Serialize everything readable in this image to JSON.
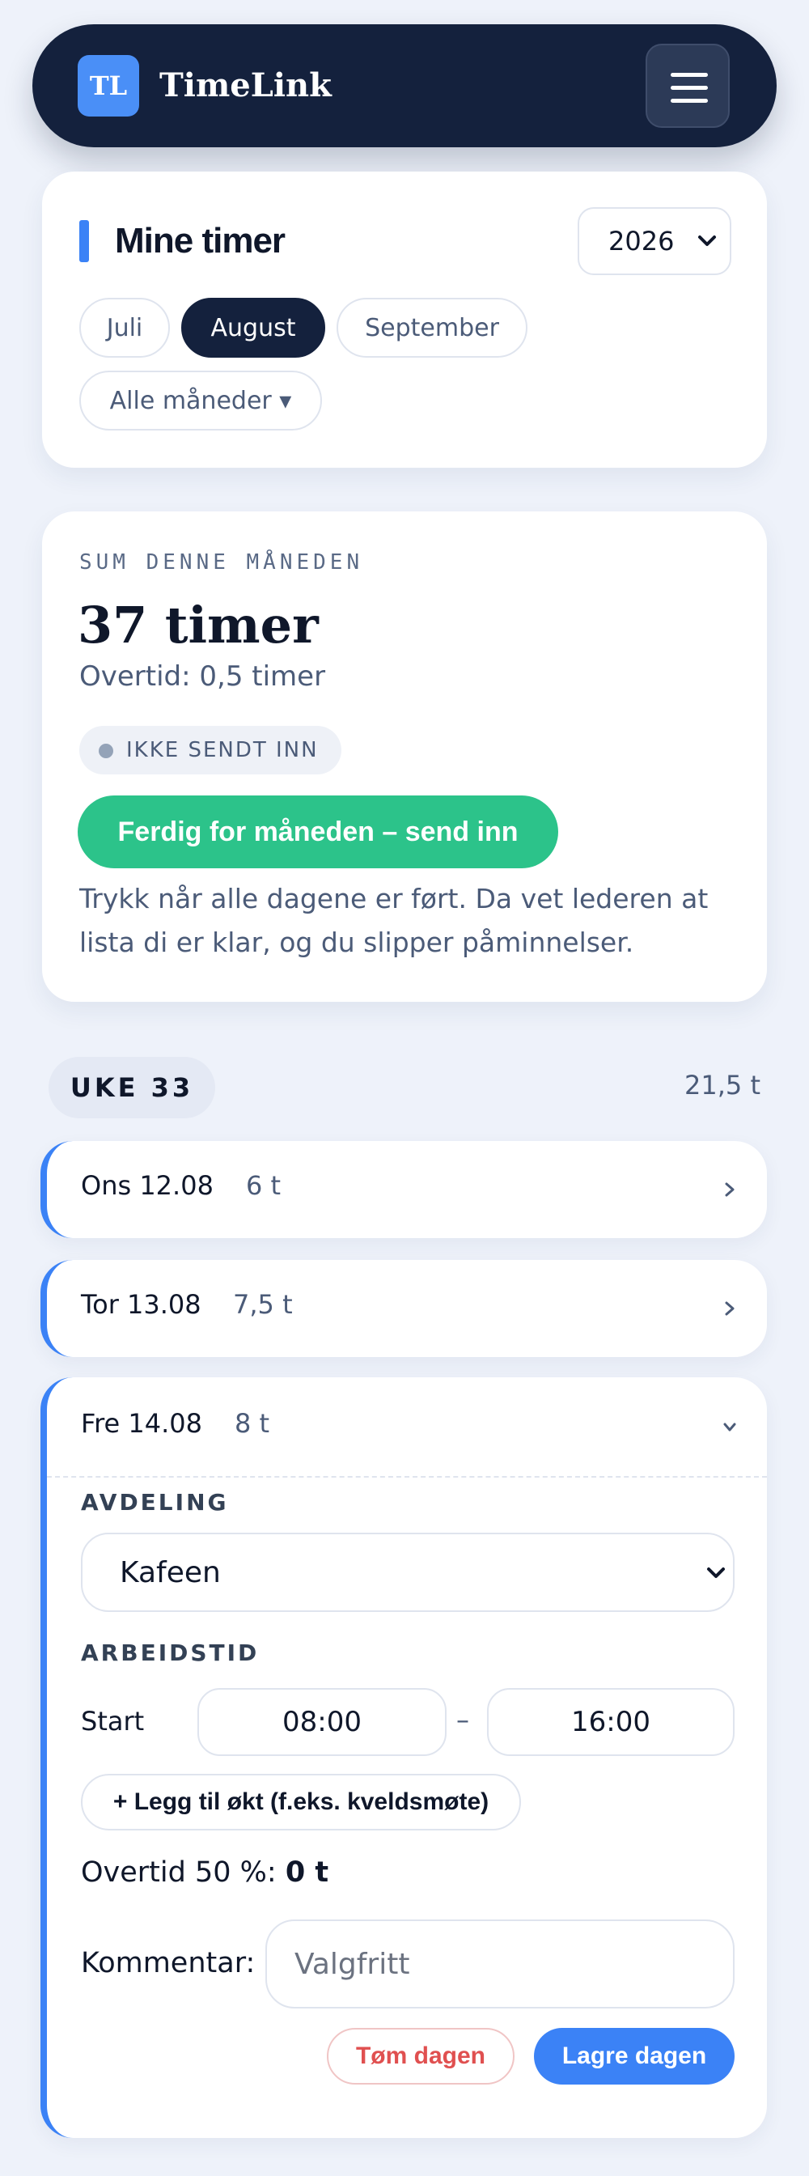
{
  "header": {
    "logo_text": "TL",
    "brand": "TimeLink",
    "menu_icon": "hamburger-icon"
  },
  "hours_card": {
    "title": "Mine timer",
    "year": "2026",
    "months": [
      {
        "label": "Juli",
        "active": false
      },
      {
        "label": "August",
        "active": true
      },
      {
        "label": "September",
        "active": false
      }
    ],
    "all_months": "Alle måneder ▾"
  },
  "summary": {
    "caption": "SUM DENNE MÅNEDEN",
    "total": "37 timer",
    "overtime": "Overtid: 0,5 timer",
    "status": "IKKE SENDT INN",
    "submit_label": "Ferdig for måneden – send inn",
    "help_text": "Trykk når alle dagene er ført. Da vet lederen at lista di er klar, og du slipper påminnelser."
  },
  "week": {
    "label": "UKE 33",
    "total": "21,5 t",
    "days": [
      {
        "name": "Ons 12.08",
        "hours": "6 t",
        "expanded": false
      },
      {
        "name": "Tor 13.08",
        "hours": "7,5 t",
        "expanded": false
      },
      {
        "name": "Fre 14.08",
        "hours": "8 t",
        "expanded": true
      }
    ]
  },
  "day_form": {
    "department_label": "AVDELING",
    "department_value": "Kafeen",
    "worktime_label": "ARBEIDSTID",
    "start_label": "Start",
    "start_time": "08:00",
    "separator": "–",
    "end_time": "16:00",
    "add_session": "+ Legg til økt (f.eks. kveldsmøte)",
    "overtime_label": "Overtid 50 %:",
    "overtime_value": "0 t",
    "comment_label": "Kommentar:",
    "comment_placeholder": "Valgfritt",
    "clear_label": "Tøm dagen",
    "save_label": "Lagre dagen"
  },
  "colors": {
    "navy": "#14213d",
    "accent": "#3b82f6",
    "green": "#2cc38a",
    "danger": "#e05050"
  }
}
